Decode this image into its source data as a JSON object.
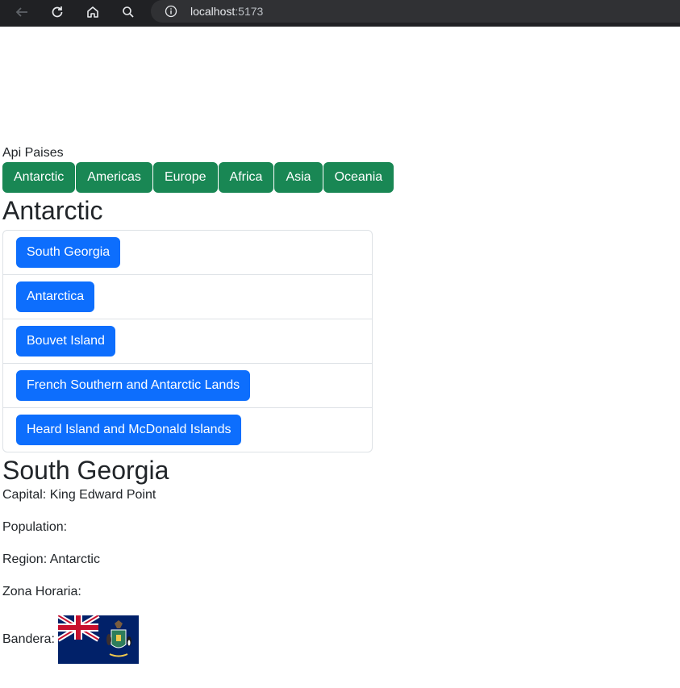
{
  "browser": {
    "url_host": "localhost",
    "url_port": ":5173"
  },
  "app": {
    "title": "Api Paises"
  },
  "regions": [
    {
      "label": "Antarctic"
    },
    {
      "label": "Americas"
    },
    {
      "label": "Europe"
    },
    {
      "label": "Africa"
    },
    {
      "label": "Asia"
    },
    {
      "label": "Oceania"
    }
  ],
  "selected_region": {
    "heading": "Antarctic",
    "countries": [
      {
        "label": "South Georgia"
      },
      {
        "label": "Antarctica"
      },
      {
        "label": "Bouvet Island"
      },
      {
        "label": "French Southern and Antarctic Lands"
      },
      {
        "label": "Heard Island and McDonald Islands"
      }
    ]
  },
  "country_detail": {
    "name": "South Georgia",
    "capital": "Capital: King Edward Point",
    "population": "Population:",
    "region": "Region: Antarctic",
    "timezone": "Zona Horaria:",
    "flag_label": "Bandera:"
  },
  "colors": {
    "region_button": "#198754",
    "country_button": "#0d6efd",
    "chrome": "#202124"
  }
}
